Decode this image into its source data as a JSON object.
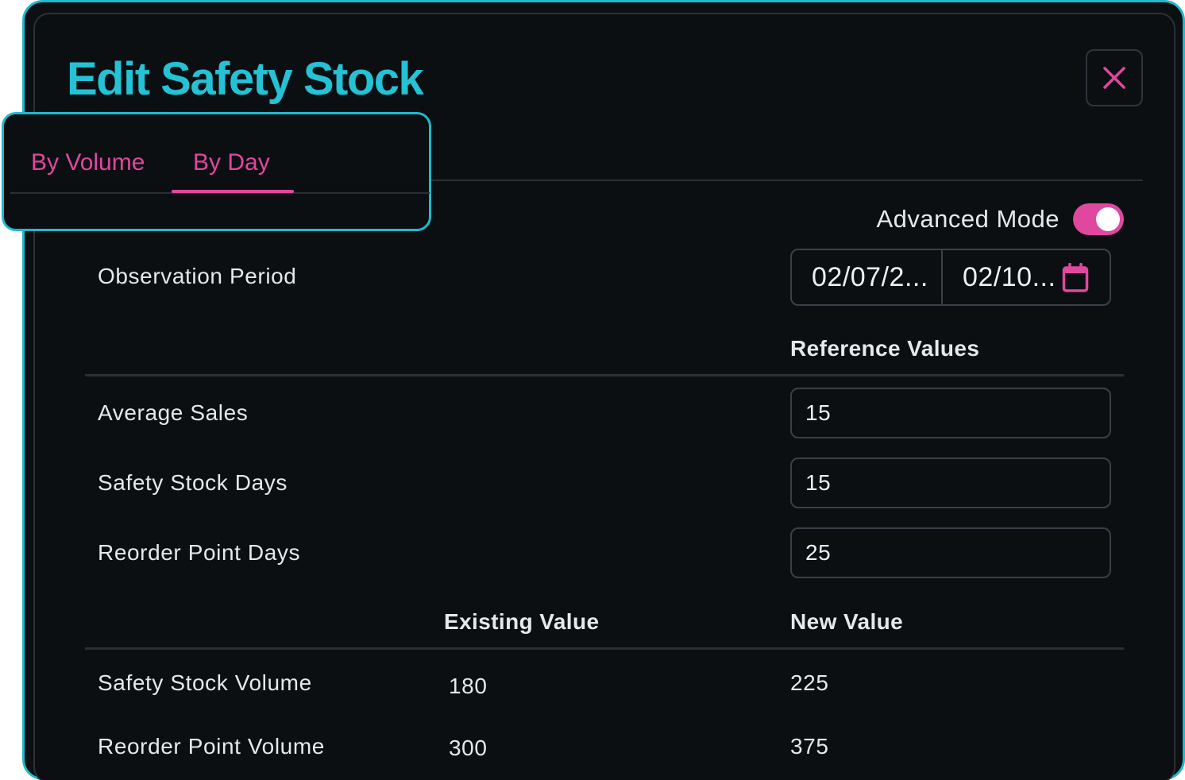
{
  "dialog": {
    "title": "Edit Safety Stock",
    "colors": {
      "accent_teal": "#25c1d4",
      "accent_pink": "#e0479e",
      "background": "#0c0f12"
    }
  },
  "tabs": [
    {
      "label": "By Volume",
      "active": false
    },
    {
      "label": "By Day",
      "active": true
    }
  ],
  "advanced_mode": {
    "label": "Advanced Mode",
    "enabled": true
  },
  "observation_period": {
    "label": "Observation Period",
    "start": "02/07/2...",
    "end": "02/10...",
    "icon": "calendar-icon"
  },
  "reference": {
    "header": "Reference Values",
    "fields": [
      {
        "label": "Average Sales",
        "value": "15"
      },
      {
        "label": "Safety Stock Days",
        "value": "15"
      },
      {
        "label": "Reorder Point Days",
        "value": "25"
      }
    ]
  },
  "results": {
    "existing_header": "Existing Value",
    "new_header": "New Value",
    "rows": [
      {
        "label": "Safety Stock Volume",
        "existing": "180",
        "new": "225"
      },
      {
        "label": "Reorder Point Volume",
        "existing": "300",
        "new": "375"
      }
    ]
  }
}
